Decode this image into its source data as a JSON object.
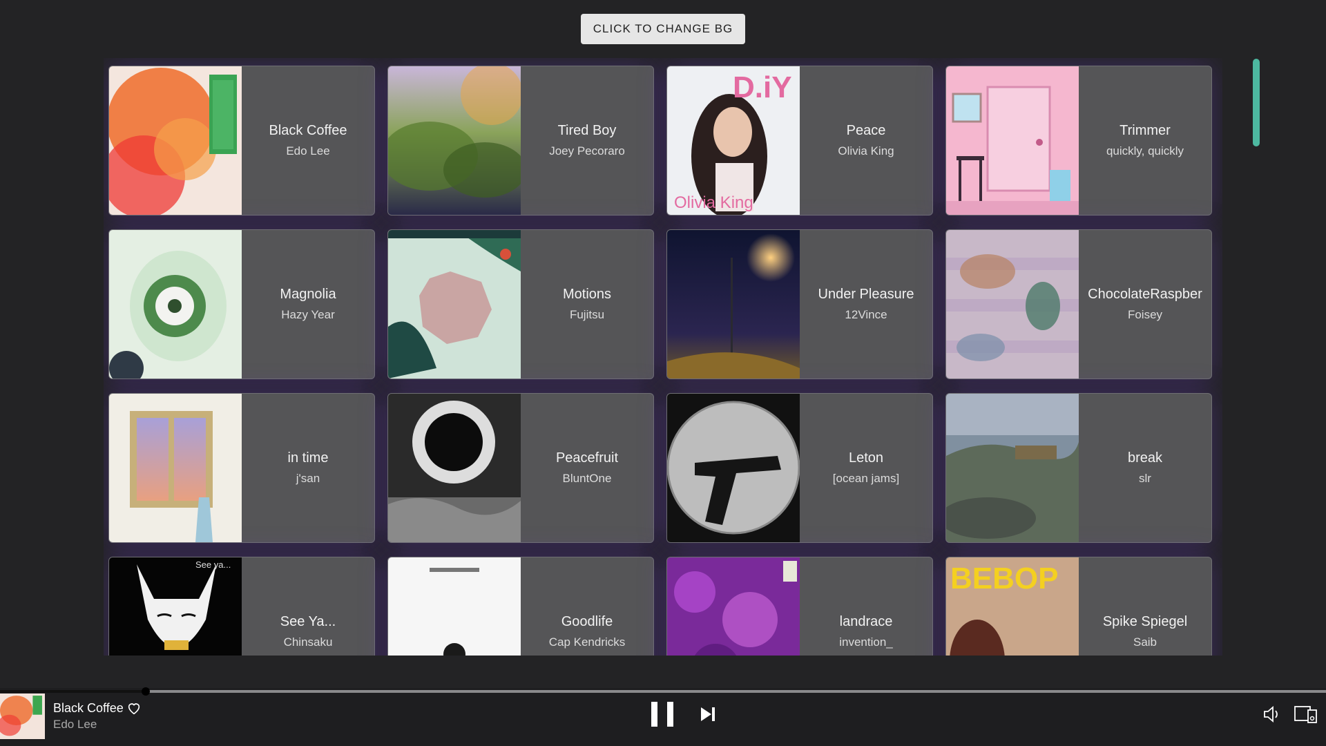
{
  "change_bg_label": "CLICK TO CHANGE BG",
  "cards": [
    {
      "title": "Black Coffee",
      "artist": "Edo Lee",
      "art": "black-coffee"
    },
    {
      "title": "Tired Boy",
      "artist": "Joey Pecoraro",
      "art": "tired-boy"
    },
    {
      "title": "Peace",
      "artist": "Olivia King",
      "art": "peace"
    },
    {
      "title": "Trimmer",
      "artist": "quickly, quickly",
      "art": "trimmer"
    },
    {
      "title": "Magnolia",
      "artist": "Hazy Year",
      "art": "magnolia"
    },
    {
      "title": "Motions",
      "artist": "Fujitsu",
      "art": "motions"
    },
    {
      "title": "Under Pleasure",
      "artist": "12Vince",
      "art": "under-pleasure"
    },
    {
      "title": "ChocolateRaspber",
      "artist": "Foisey",
      "art": "chocolate-raspber"
    },
    {
      "title": "in time",
      "artist": "j'san",
      "art": "in-time"
    },
    {
      "title": "Peacefruit",
      "artist": "BluntOne",
      "art": "peacefruit"
    },
    {
      "title": "Leton",
      "artist": "[ocean jams]",
      "art": "leton"
    },
    {
      "title": "break",
      "artist": "slr",
      "art": "break"
    },
    {
      "title": "See Ya...",
      "artist": "Chinsaku",
      "art": "see-ya"
    },
    {
      "title": "Goodlife",
      "artist": "Cap Kendricks",
      "art": "goodlife"
    },
    {
      "title": "landrace",
      "artist": "invention_",
      "art": "landrace"
    },
    {
      "title": "Spike Spiegel",
      "artist": "Saib",
      "art": "spike-spiegel"
    }
  ],
  "art_text": {
    "peace": "D.iY",
    "peace_sub": "Olivia King",
    "see_ya": "See ya...",
    "spike": "BEBOP"
  },
  "player": {
    "title": "Black Coffee",
    "artist": "Edo Lee",
    "progress": 0.11,
    "icons": {
      "like": "heart-icon",
      "play_state": "pause-icon",
      "next": "skip-next-icon",
      "volume": "volume-icon",
      "device": "device-icon"
    }
  },
  "colors": {
    "accent": "#4db8a0",
    "background": "#232325",
    "card": "#555557",
    "glow": "#6e3cc8"
  }
}
